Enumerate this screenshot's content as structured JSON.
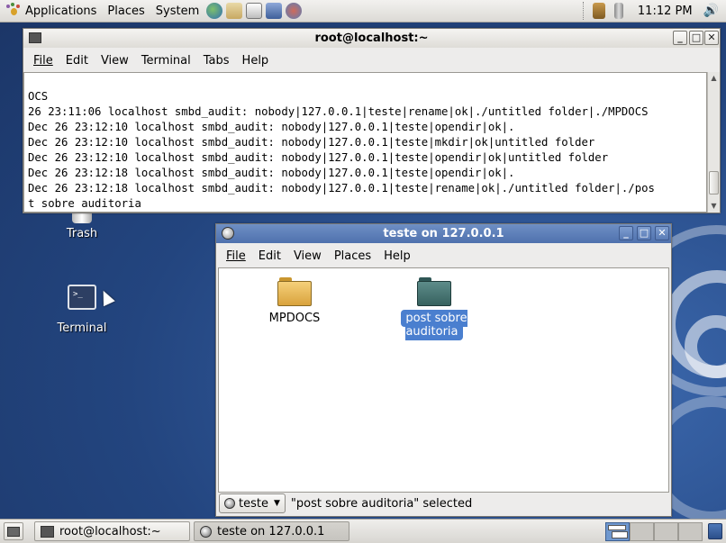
{
  "top_panel": {
    "menus": [
      "Applications",
      "Places",
      "System"
    ],
    "clock": "11:12 PM"
  },
  "desktop": {
    "icons": [
      {
        "label": "Trash",
        "icon": "trash-icon"
      },
      {
        "label": "Terminal",
        "icon": "terminal-icon"
      }
    ]
  },
  "terminal": {
    "title": "root@localhost:~",
    "menus": [
      "File",
      "Edit",
      "View",
      "Terminal",
      "Tabs",
      "Help"
    ],
    "lines": [
      "OCS",
      "26 23:11:06 localhost smbd_audit: nobody|127.0.0.1|teste|rename|ok|./untitled folder|./MPDOCS",
      "Dec 26 23:12:10 localhost smbd_audit: nobody|127.0.0.1|teste|opendir|ok|.",
      "Dec 26 23:12:10 localhost smbd_audit: nobody|127.0.0.1|teste|mkdir|ok|untitled folder",
      "Dec 26 23:12:10 localhost smbd_audit: nobody|127.0.0.1|teste|opendir|ok|untitled folder",
      "Dec 26 23:12:18 localhost smbd_audit: nobody|127.0.0.1|teste|opendir|ok|.",
      "Dec 26 23:12:18 localhost smbd_audit: nobody|127.0.0.1|teste|rename|ok|./untitled folder|./pos",
      "t sobre auditoria"
    ]
  },
  "filemanager": {
    "title": "teste on 127.0.0.1",
    "menus": [
      "File",
      "Edit",
      "View",
      "Places",
      "Help"
    ],
    "items": [
      {
        "label": "MPDOCS",
        "selected": false
      },
      {
        "label": "post sobre auditoria",
        "selected": true
      }
    ],
    "location": "teste",
    "status": "\"post sobre auditoria\" selected"
  },
  "taskbar": {
    "items": [
      "root@localhost:~",
      "teste on 127.0.0.1"
    ]
  },
  "colors": {
    "selection": "#4a7fcf",
    "folder_plain": "#e3b44f",
    "folder_selected": "#3f6d6c"
  }
}
